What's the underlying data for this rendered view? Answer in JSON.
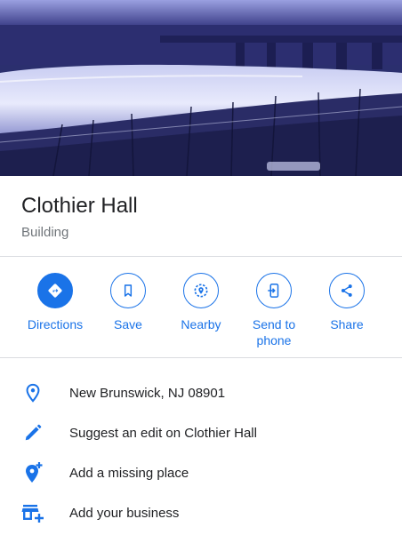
{
  "place": {
    "name": "Clothier Hall",
    "type": "Building"
  },
  "actions": [
    {
      "label": "Directions",
      "icon": "directions-icon"
    },
    {
      "label": "Save",
      "icon": "bookmark-icon"
    },
    {
      "label": "Nearby",
      "icon": "nearby-icon"
    },
    {
      "label": "Send to phone",
      "icon": "send-to-phone-icon"
    },
    {
      "label": "Share",
      "icon": "share-icon"
    }
  ],
  "details": [
    {
      "text": "New Brunswick, NJ 08901",
      "icon": "location-pin-icon"
    },
    {
      "text": "Suggest an edit on Clothier Hall",
      "icon": "pencil-icon"
    },
    {
      "text": "Add a missing place",
      "icon": "add-location-icon"
    },
    {
      "text": "Add your business",
      "icon": "add-business-icon"
    }
  ],
  "colors": {
    "accent": "#1a73e8",
    "text": "#202124",
    "secondary": "#70757a",
    "divider": "#dadce0"
  }
}
